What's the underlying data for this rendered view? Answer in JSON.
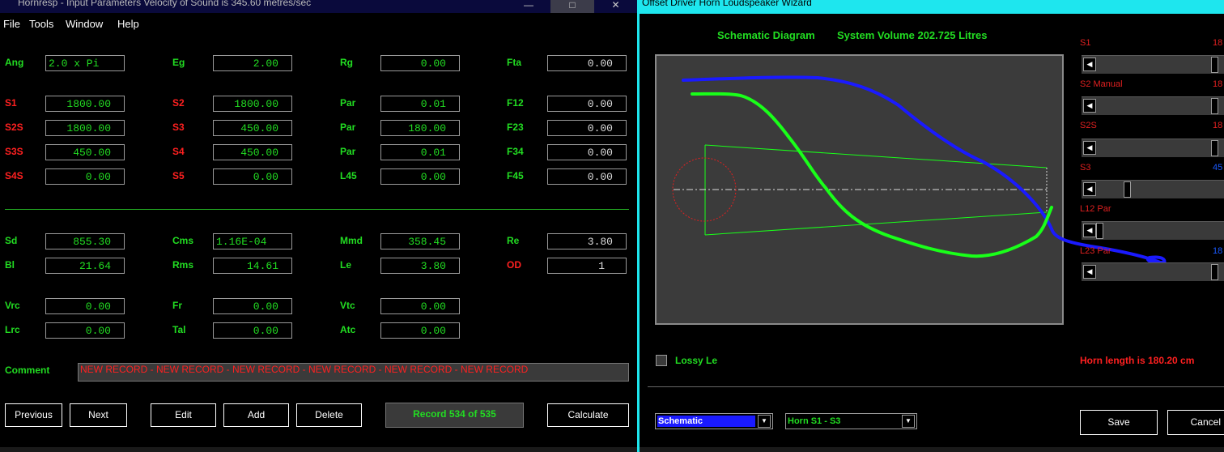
{
  "left_window": {
    "title": "Hornresp - Input Parameters   Velocity of Sound is 345.60 metres/sec",
    "menu": [
      "File",
      "Tools",
      "Window",
      "Help"
    ],
    "params": {
      "Ang": {
        "label": "Ang",
        "value": "2.0 x Pi"
      },
      "Eg": {
        "label": "Eg",
        "value": "2.00"
      },
      "Rg": {
        "label": "Rg",
        "value": "0.00"
      },
      "Fta": {
        "label": "Fta",
        "value": "0.00"
      },
      "S1": {
        "label": "S1",
        "value": "1800.00"
      },
      "S2": {
        "label": "S2",
        "value": "1800.00"
      },
      "Par1": {
        "label": "Par",
        "value": "0.01"
      },
      "F12": {
        "label": "F12",
        "value": "0.00"
      },
      "S2S": {
        "label": "S2S",
        "value": "1800.00"
      },
      "S3": {
        "label": "S3",
        "value": "450.00"
      },
      "Par2": {
        "label": "Par",
        "value": "180.00"
      },
      "F23": {
        "label": "F23",
        "value": "0.00"
      },
      "S3S": {
        "label": "S3S",
        "value": "450.00"
      },
      "S4": {
        "label": "S4",
        "value": "450.00"
      },
      "Par3": {
        "label": "Par",
        "value": "0.01"
      },
      "F34": {
        "label": "F34",
        "value": "0.00"
      },
      "S4S": {
        "label": "S4S",
        "value": "0.00"
      },
      "S5": {
        "label": "S5",
        "value": "0.00"
      },
      "L45": {
        "label": "L45",
        "value": "0.00"
      },
      "F45": {
        "label": "F45",
        "value": "0.00"
      },
      "Sd": {
        "label": "Sd",
        "value": "855.30"
      },
      "Cms": {
        "label": "Cms",
        "value": "1.16E-04"
      },
      "Mmd": {
        "label": "Mmd",
        "value": "358.45"
      },
      "Re": {
        "label": "Re",
        "value": "3.80"
      },
      "Bl": {
        "label": "Bl",
        "value": "21.64"
      },
      "Rms": {
        "label": "Rms",
        "value": "14.61"
      },
      "Le": {
        "label": "Le",
        "value": "3.80"
      },
      "OD": {
        "label": "OD",
        "value": "1"
      },
      "Vrc": {
        "label": "Vrc",
        "value": "0.00"
      },
      "Fr": {
        "label": "Fr",
        "value": "0.00"
      },
      "Vtc": {
        "label": "Vtc",
        "value": "0.00"
      },
      "Lrc": {
        "label": "Lrc",
        "value": "0.00"
      },
      "Tal": {
        "label": "Tal",
        "value": "0.00"
      },
      "Atc": {
        "label": "Atc",
        "value": "0.00"
      }
    },
    "comment_label": "Comment",
    "comment_value": "NEW RECORD - NEW RECORD - NEW RECORD - NEW RECORD - NEW RECORD - NEW RECORD",
    "buttons": {
      "previous": "Previous",
      "next": "Next",
      "edit": "Edit",
      "add": "Add",
      "delete": "Delete",
      "calculate": "Calculate"
    },
    "record_status": "Record 534 of 535",
    "window_controls": {
      "minimize": "—",
      "maximize": "□",
      "close": "✕"
    }
  },
  "right_window": {
    "title": "Offset Driver Horn Loudspeaker Wizard",
    "schematic_title": "Schematic Diagram",
    "system_volume": "System Volume 202.725 Litres",
    "sliders": [
      {
        "label": "S1",
        "value": "18",
        "fraction": 1.0
      },
      {
        "label": "S2 Manual",
        "value": "18",
        "fraction": 1.0
      },
      {
        "label": "S2S",
        "value": "18",
        "fraction": 1.0
      },
      {
        "label": "S3",
        "value": "45",
        "fraction": 0.25
      },
      {
        "label": "L12 Par",
        "value": "",
        "fraction": 0.0
      },
      {
        "label": "L23 Par",
        "value": "18",
        "fraction": 1.0
      }
    ],
    "lossy_label": "Lossy Le",
    "horn_length": "Horn length is 180.20 cm",
    "dropdown1": "Schematic",
    "dropdown2": "Horn S1 - S3",
    "save": "Save",
    "cancel": "Cancel",
    "colors": {
      "accent_cyan": "#1ee6ee",
      "label_green": "#22dd22",
      "label_red": "#ff2020",
      "ink_blue": "#1a1aff",
      "ink_green": "#19ff19"
    }
  }
}
